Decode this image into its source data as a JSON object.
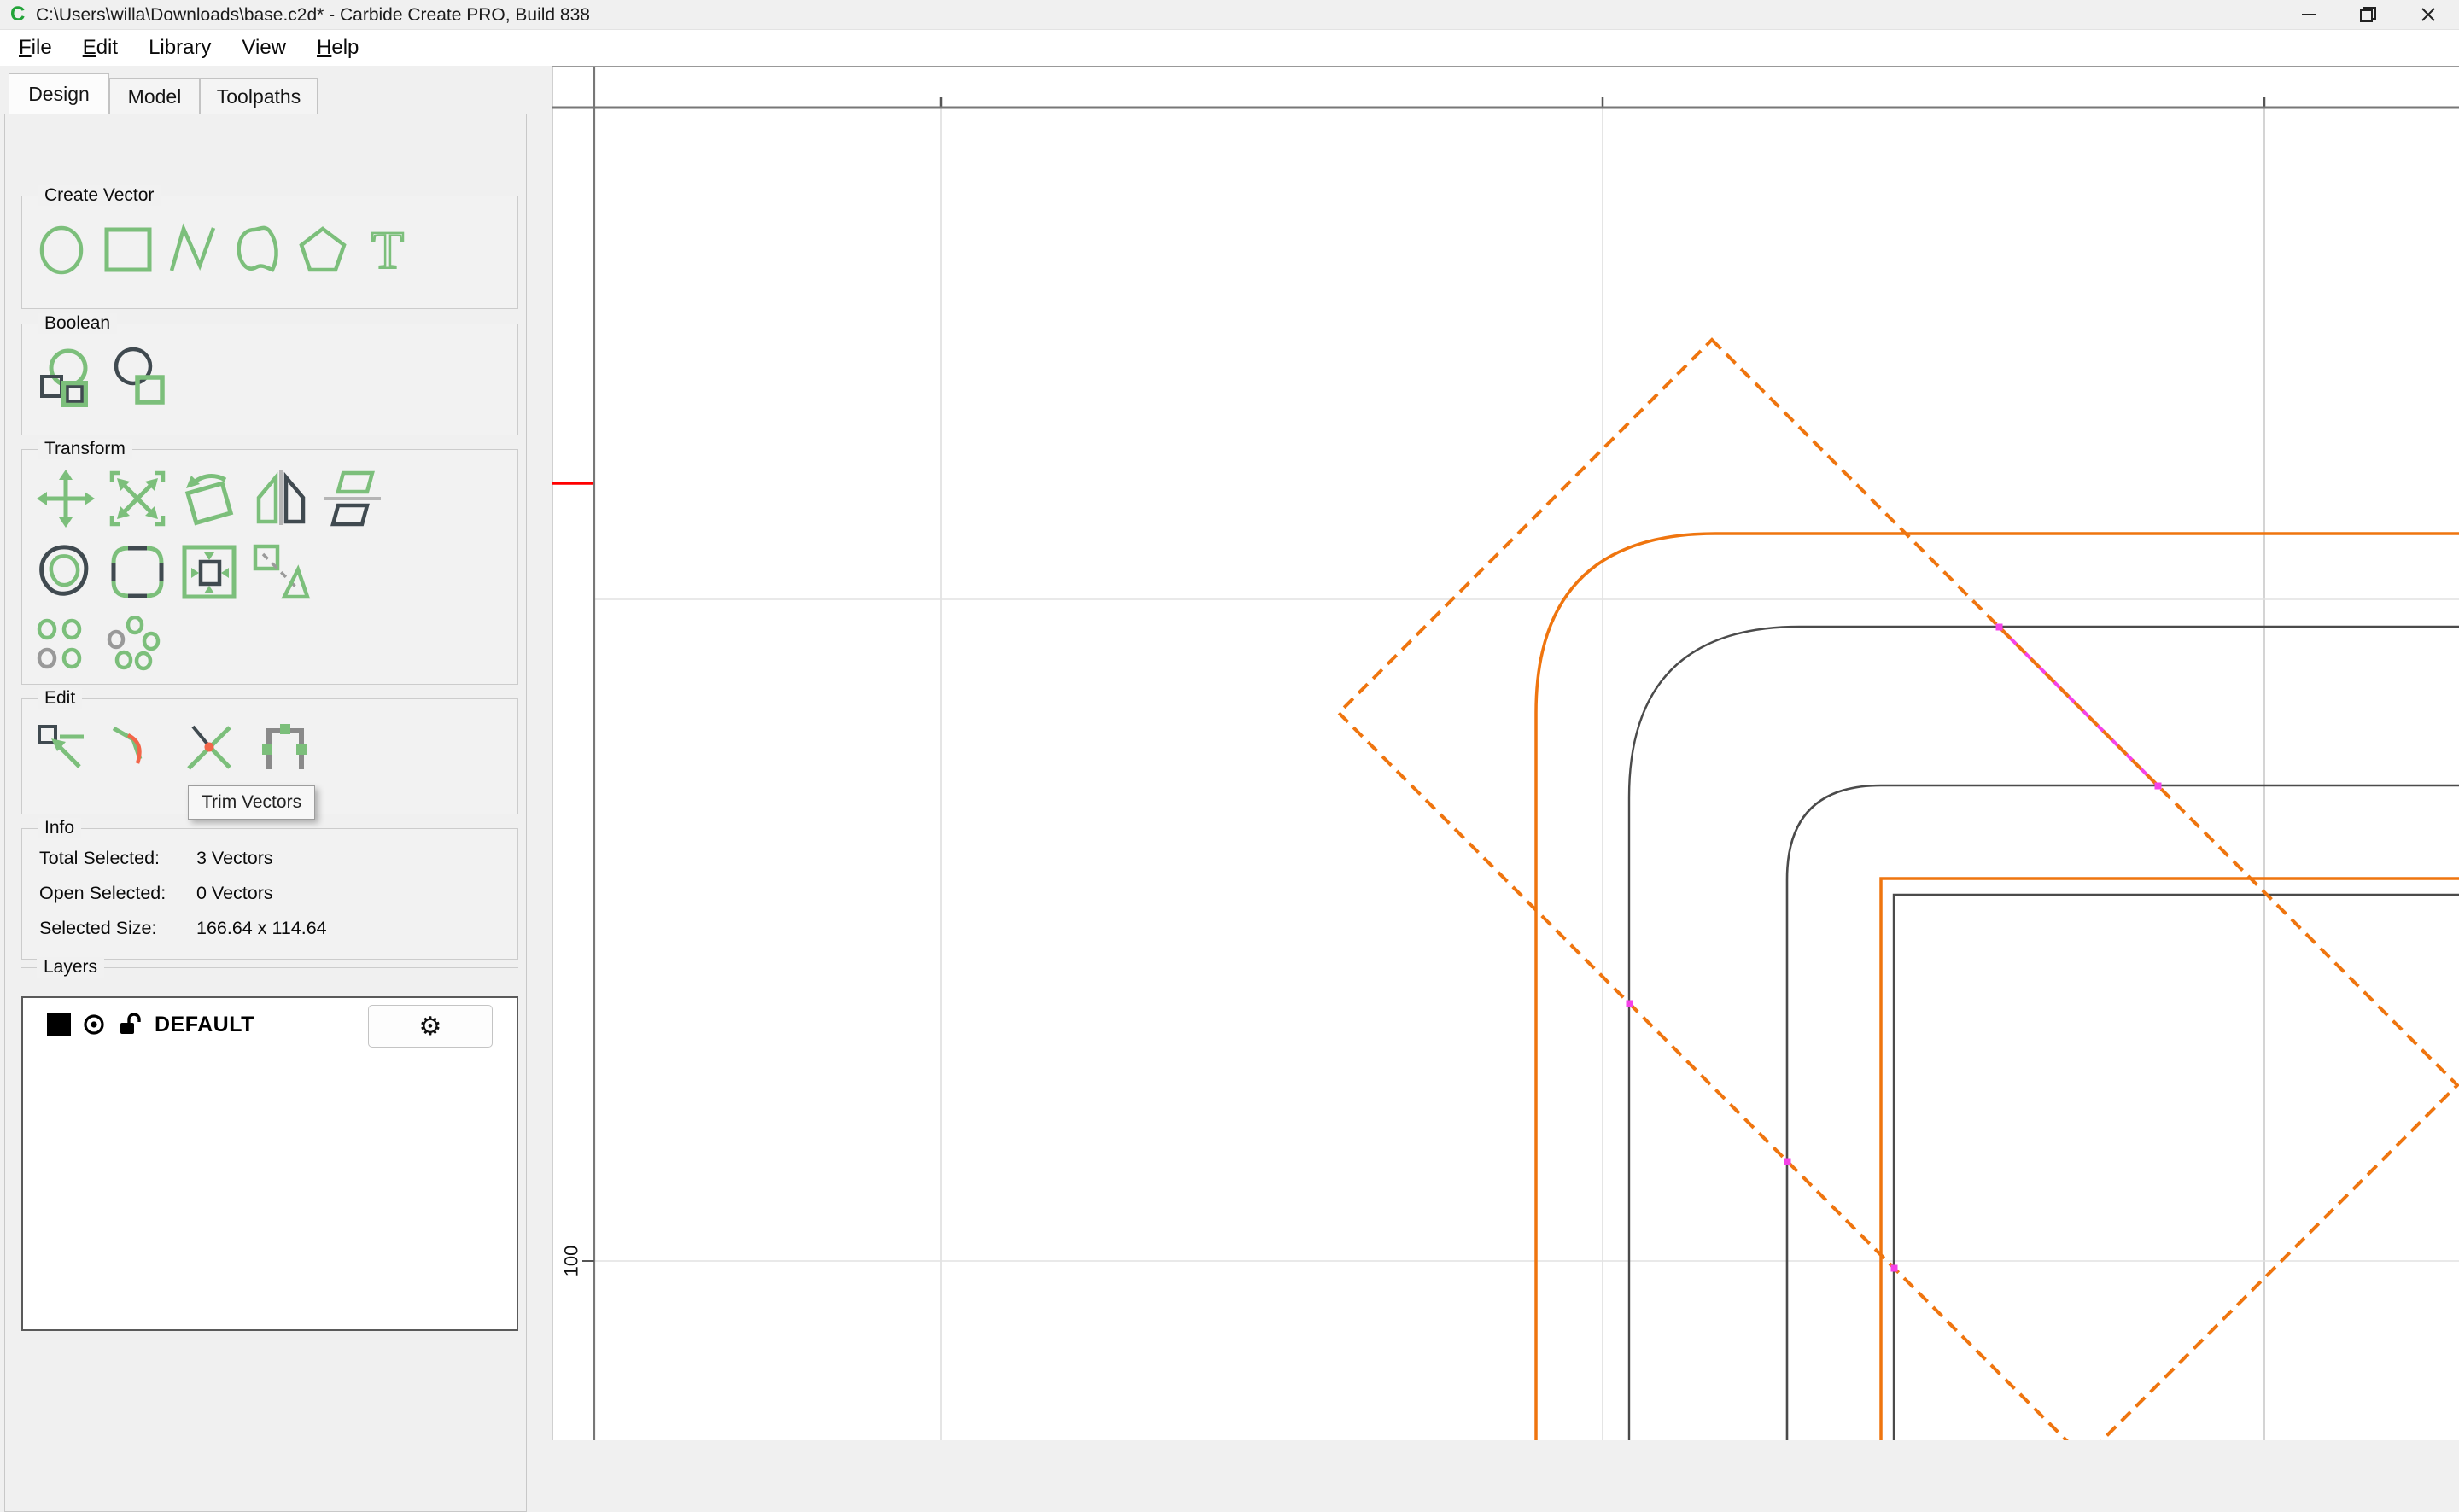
{
  "window": {
    "logo_glyph": "C",
    "title": "C:\\Users\\willa\\Downloads\\base.c2d* - Carbide Create PRO, Build 838",
    "controls": [
      "minimize",
      "restore",
      "close"
    ]
  },
  "menubar": {
    "items": [
      {
        "key": "F",
        "rest": "ile"
      },
      {
        "key": "E",
        "rest": "dit"
      },
      {
        "key": "",
        "rest": "Library"
      },
      {
        "key": "",
        "rest": "View"
      },
      {
        "key": "H",
        "rest": "elp"
      }
    ]
  },
  "tabs": [
    {
      "label": "Design",
      "active": true
    },
    {
      "label": "Model",
      "active": false
    },
    {
      "label": "Toolpaths",
      "active": false
    }
  ],
  "sidebar": {
    "create_vector": {
      "label": "Create Vector",
      "icons": [
        "circle-icon",
        "rectangle-icon",
        "polyline-icon",
        "curve-icon",
        "polygon-icon",
        "text-icon"
      ]
    },
    "boolean": {
      "label": "Boolean",
      "icons": [
        "boolean-union-icon",
        "boolean-subtract-icon"
      ]
    },
    "transform": {
      "label": "Transform",
      "icons": [
        "move-icon",
        "scale-icon",
        "rotate-icon",
        "mirror-horizontal-icon",
        "flip-vertical-icon",
        "offset-icon",
        "round-corners-icon",
        "fit-to-stock-icon",
        "skew-icon",
        "grid-array-icon",
        "circular-array-icon"
      ]
    },
    "edit": {
      "label": "Edit",
      "icons": [
        "edit-nodes-icon",
        "fair-curve-icon",
        "trim-vectors-icon",
        "join-vectors-icon"
      ],
      "tooltip": "Trim Vectors"
    },
    "info": {
      "label": "Info",
      "rows": [
        {
          "label": "Total Selected:",
          "value": "3 Vectors"
        },
        {
          "label": "Open Selected:",
          "value": "0 Vectors"
        },
        {
          "label": "Selected Size:",
          "value": "166.64 x 114.64"
        }
      ]
    },
    "layers": {
      "label": "Layers",
      "layer_name": "DEFAULT",
      "icons": [
        "layer-color-swatch",
        "visibility-eye-icon",
        "unlock-icon",
        "gear-icon"
      ]
    }
  },
  "canvas": {
    "ruler_label": "100"
  },
  "colors": {
    "accent_green": "#7cbf7b",
    "logo_green": "#23a439",
    "icon_slate": "#404a50",
    "selection_orange": "#ef750f",
    "trim_magenta": "#f542e8",
    "ruler_marker_red": "#ff0000",
    "vector_gray": "#4b4b4b",
    "grid_light": "#e2e2e2"
  }
}
